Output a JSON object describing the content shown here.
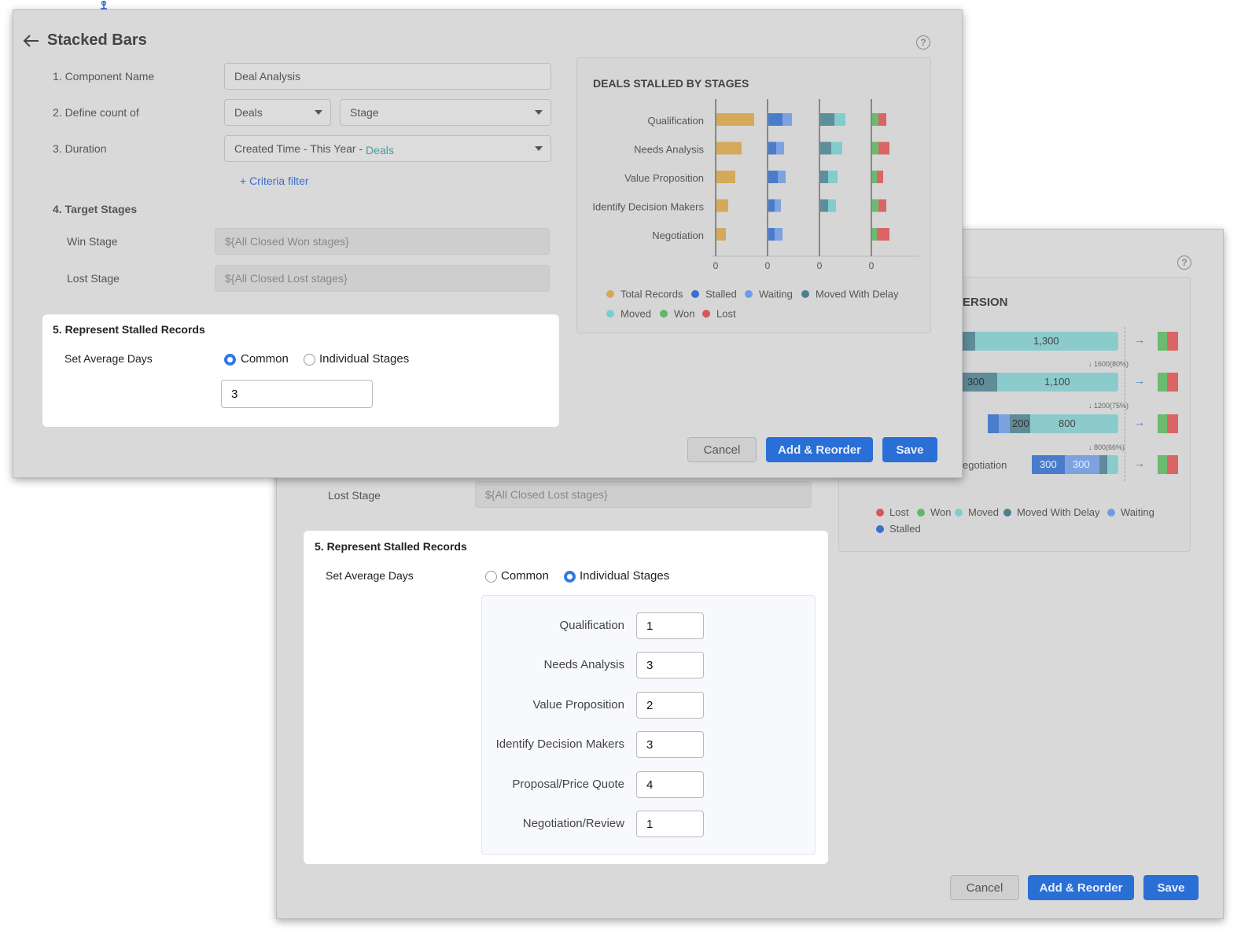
{
  "front": {
    "title": "Stacked Bars",
    "help": "?",
    "form": {
      "component_name_label": "1. Component Name",
      "component_name_value": "Deal Analysis",
      "define_count_label": "2. Define count of",
      "module_value": "Deals",
      "field_value": "Stage",
      "duration_label": "3. Duration",
      "duration_value": "Created Time - This Year - ",
      "duration_suffix": "Deals",
      "criteria_link": "+ Criteria filter",
      "target_stages_label": "4. Target Stages",
      "win_stage_label": "Win Stage",
      "win_stage_value": "${All Closed Won stages}",
      "lost_stage_label": "Lost Stage",
      "lost_stage_value": "${All Closed Lost stages}"
    },
    "stalled": {
      "title": "5. Represent Stalled Records",
      "avg_days_label": "Set Average Days",
      "opt_common": "Common",
      "opt_individual": "Individual Stages",
      "selected": "common",
      "common_value": "3"
    },
    "buttons": {
      "cancel": "Cancel",
      "add_reorder": "Add & Reorder",
      "save": "Save"
    }
  },
  "back": {
    "help": "?",
    "chart_title_partial": "ERSION",
    "lost_stage_label": "Lost Stage",
    "lost_stage_value": "${All Closed Lost stages}",
    "stalled": {
      "title": "5. Represent Stalled Records",
      "avg_days_label": "Set Average Days",
      "opt_common": "Common",
      "opt_individual": "Individual Stages",
      "selected": "individual",
      "stages": [
        {
          "label": "Qualification",
          "value": "1"
        },
        {
          "label": "Needs Analysis",
          "value": "3"
        },
        {
          "label": "Value Proposition",
          "value": "2"
        },
        {
          "label": "Identify Decision Makers",
          "value": "3"
        },
        {
          "label": "Proposal/Price Quote",
          "value": "4"
        },
        {
          "label": "Negotiation/Review",
          "value": "1"
        }
      ]
    },
    "funnel_labels": [
      "1,300",
      "300",
      "1,100",
      "200",
      "800",
      "300",
      "300"
    ],
    "funnel_drops": [
      "↓ 1600(80%)",
      "↓ 1200(75%)",
      "↓ 800(66%)"
    ],
    "funnel_partial_label": "egotiation",
    "legend": [
      "Lost",
      "Won",
      "Moved",
      "Moved With Delay",
      "Waiting",
      "Stalled"
    ],
    "buttons": {
      "cancel": "Cancel",
      "add_reorder": "Add & Reorder",
      "save": "Save"
    }
  },
  "chart_data": {
    "type": "bar",
    "title": "DEALS STALLED BY STAGES",
    "categories": [
      "Qualification",
      "Needs Analysis",
      "Value Proposition",
      "Identify Decision Makers",
      "Negotiation"
    ],
    "panels": [
      {
        "name": "Total Records",
        "tick": "0",
        "series": [
          {
            "name": "Total Records",
            "color": "#d4aa5a",
            "values": [
              48,
              32,
              24,
              15,
              12
            ]
          }
        ]
      },
      {
        "name": "Stalled/Waiting",
        "tick": "0",
        "series": [
          {
            "name": "Stalled",
            "color": "#4a7ccc",
            "values": [
              18,
              10,
              12,
              8,
              8
            ]
          },
          {
            "name": "Waiting",
            "color": "#7ea2e0",
            "values": [
              12,
              10,
              10,
              8,
              10
            ]
          }
        ]
      },
      {
        "name": "Moved With Delay/Moved",
        "tick": "0",
        "series": [
          {
            "name": "Moved With Delay",
            "color": "#5e8e9a",
            "values": [
              18,
              14,
              10,
              10,
              0
            ]
          },
          {
            "name": "Moved",
            "color": "#82cccb",
            "values": [
              14,
              14,
              12,
              10,
              0
            ]
          }
        ]
      },
      {
        "name": "Won/Lost",
        "tick": "0",
        "series": [
          {
            "name": "Won",
            "color": "#6cba70",
            "values": [
              8,
              8,
              6,
              8,
              6
            ]
          },
          {
            "name": "Lost",
            "color": "#d96565",
            "values": [
              10,
              14,
              8,
              10,
              16
            ]
          }
        ]
      }
    ],
    "legend": [
      {
        "name": "Total Records",
        "color": "#d4aa5a"
      },
      {
        "name": "Stalled",
        "color": "#3d6fcf"
      },
      {
        "name": "Waiting",
        "color": "#6f9be6"
      },
      {
        "name": "Moved With Delay",
        "color": "#4f7f8d"
      },
      {
        "name": "Moved",
        "color": "#79cfd0"
      },
      {
        "name": "Won",
        "color": "#5fb865"
      },
      {
        "name": "Lost",
        "color": "#d95656"
      }
    ]
  }
}
